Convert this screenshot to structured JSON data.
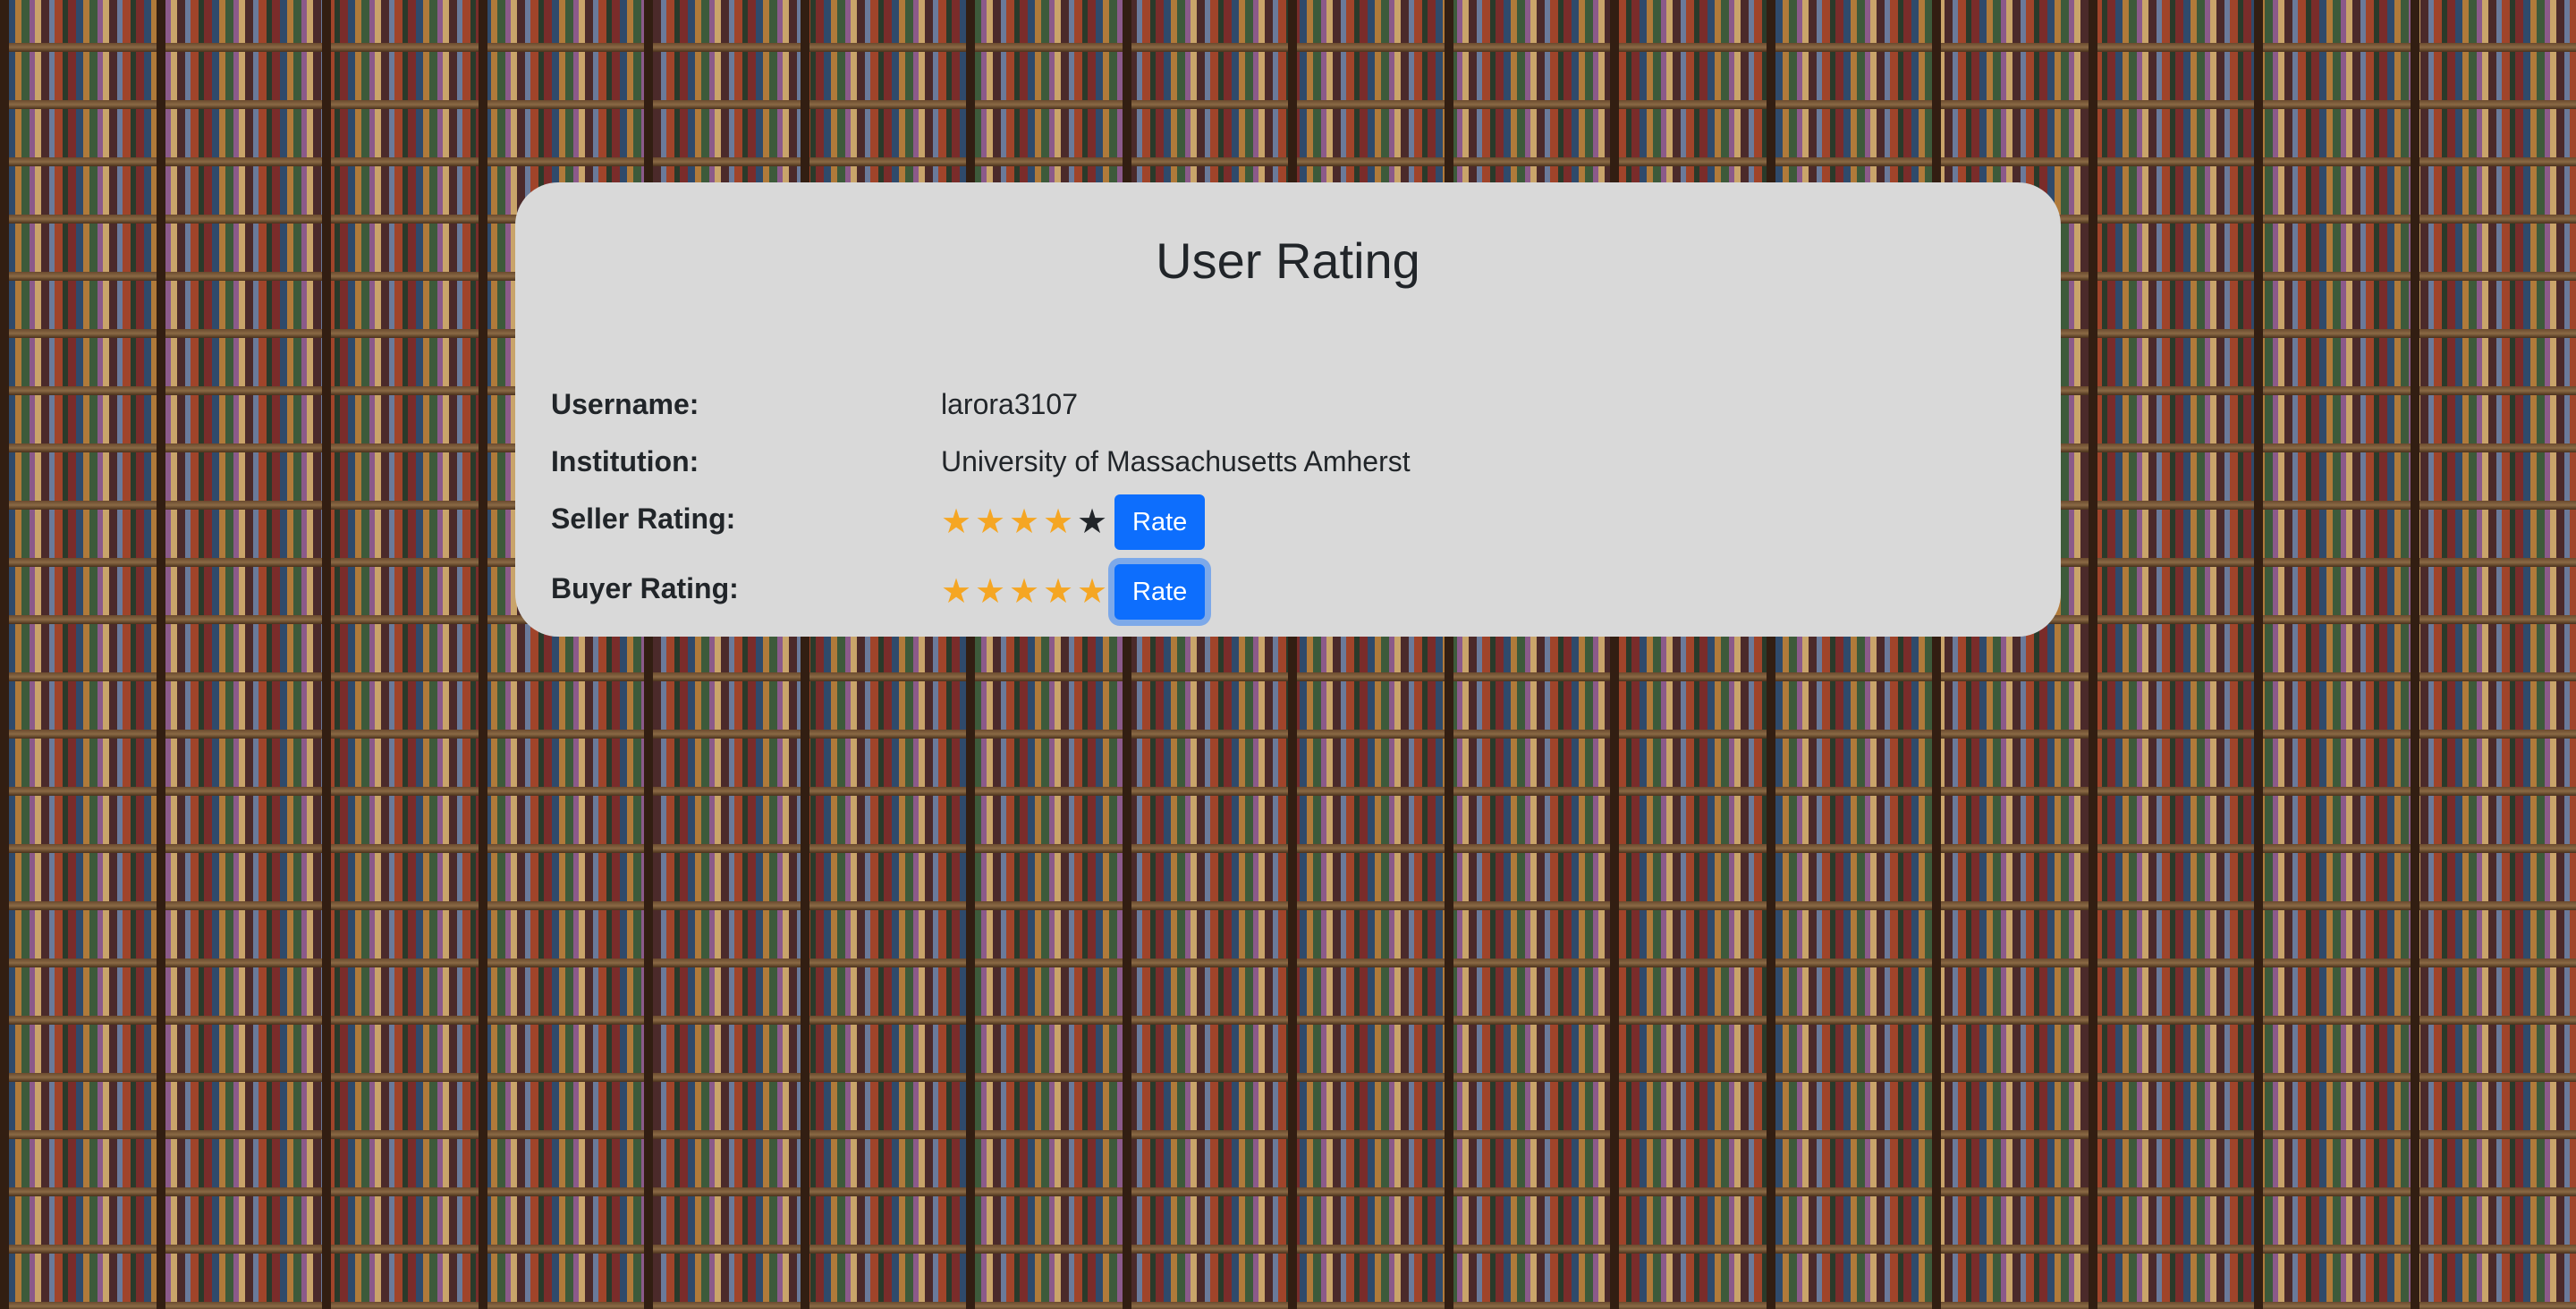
{
  "card": {
    "title": "User Rating"
  },
  "fields": {
    "username_label": "Username:",
    "username_value": "larora3107",
    "institution_label": "Institution:",
    "institution_value": "University of Massachusetts Amherst",
    "seller_label": "Seller Rating:",
    "seller_rating": 4,
    "seller_rating_max": 5,
    "seller_rate_button": "Rate",
    "buyer_label": "Buyer Rating:",
    "buyer_rating": 5,
    "buyer_rating_max": 5,
    "buyer_rate_button": "Rate"
  },
  "colors": {
    "card_background": "#d9d9d9",
    "star_filled": "#f5a623",
    "star_empty": "#212529",
    "button_primary": "#0d6efd"
  },
  "icons": {
    "star": "star-icon"
  }
}
